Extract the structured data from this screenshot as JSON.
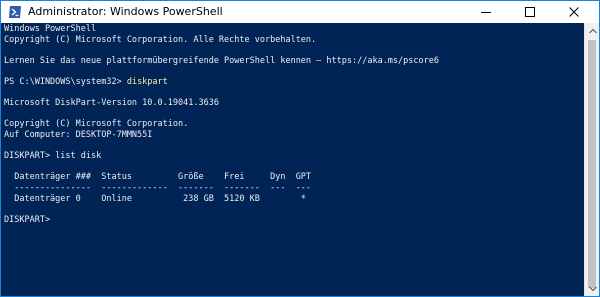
{
  "window": {
    "title": "Administrator: Windows PowerShell",
    "accent": "#1883d7",
    "console_bg": "#012456",
    "console_fg": "#eeedf0",
    "highlight_fg": "#f9f1a5"
  },
  "icons": {
    "app": "powershell-icon",
    "minimize": "minimize-icon",
    "maximize": "maximize-icon",
    "close": "close-icon",
    "scroll_up": "chevron-up-icon",
    "scroll_down": "chevron-down-icon"
  },
  "console": {
    "lines": [
      {
        "text": "Windows PowerShell"
      },
      {
        "text": "Copyright (C) Microsoft Corporation. Alle Rechte vorbehalten."
      },
      {
        "text": ""
      },
      {
        "text": "Lernen Sie das neue plattformübergreifende PowerShell kennen – https://aka.ms/pscore6"
      },
      {
        "text": ""
      },
      {
        "text": "PS C:\\WINDOWS\\system32> ",
        "cmd": "diskpart"
      },
      {
        "text": ""
      },
      {
        "text": "Microsoft DiskPart-Version 10.0.19041.3636"
      },
      {
        "text": ""
      },
      {
        "text": "Copyright (C) Microsoft Corporation."
      },
      {
        "text": "Auf Computer: DESKTOP-7MMN55I"
      },
      {
        "text": ""
      },
      {
        "text": "DISKPART> list disk"
      },
      {
        "text": ""
      },
      {
        "text": "  Datenträger ###  Status         Größe    Frei     Dyn  GPT"
      },
      {
        "text": "  ---------------  -------------  -------  -------  ---  ---"
      },
      {
        "text": "  Datenträger 0    Online          238 GB  5120 KB        *"
      },
      {
        "text": ""
      },
      {
        "text": "DISKPART>"
      }
    ]
  }
}
